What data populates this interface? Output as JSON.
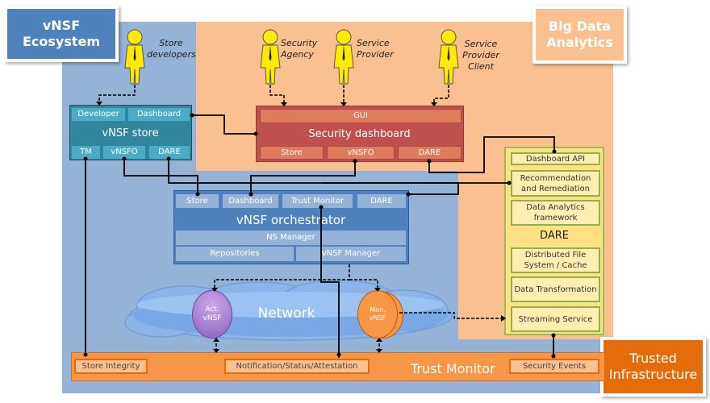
{
  "regions": {
    "ecosystem": "vNSF Ecosystem",
    "big_data": "Big Data Analytics",
    "trusted": "Trusted Infrastructure"
  },
  "actors": [
    {
      "label": "Store developers"
    },
    {
      "label": "Security Agency"
    },
    {
      "label": "Service Provider"
    },
    {
      "label": "Service Provider Client"
    }
  ],
  "store": {
    "title": "vNSF store",
    "top": [
      "Developer",
      "Dashboard"
    ],
    "bottom": [
      "TM",
      "vNSFO",
      "DARE"
    ]
  },
  "dashboard": {
    "title": "Security dashboard",
    "gui": "GUI",
    "bottom": [
      "Store",
      "vNSFO",
      "DARE"
    ]
  },
  "orchestrator": {
    "title": "vNSF orchestrator",
    "top": [
      "Store",
      "Dashboard",
      "Trust Monitor",
      "DARE"
    ],
    "ns_manager": "NS Manager",
    "repositories": "Repositories",
    "vnsf_manager": "vNSF Manager"
  },
  "dare": {
    "title": "DARE",
    "items": [
      "Dashboard API",
      "Recommendation and Remediation",
      "Data Analytics framework",
      "Distributed File System / Cache",
      "Data Transformation",
      "Streaming Service"
    ]
  },
  "network": {
    "label": "Network",
    "act": "Act. vNSF",
    "mon": "Mon. vNSF"
  },
  "trust_monitor": {
    "title": "Trust Monitor",
    "items": [
      "Store Integrity",
      "Notification/Status/Attestation",
      "Security Events"
    ]
  },
  "colors": {
    "blue": "#4f81bd",
    "light_blue": "#95b3d7",
    "orange_bg": "#fac08f",
    "teal": "#31859c",
    "red": "#c0504d",
    "trust": "#f79646",
    "dark_orange": "#e46c0a",
    "dare_yellow": "#ffe082",
    "purple": "#b48ed8"
  }
}
